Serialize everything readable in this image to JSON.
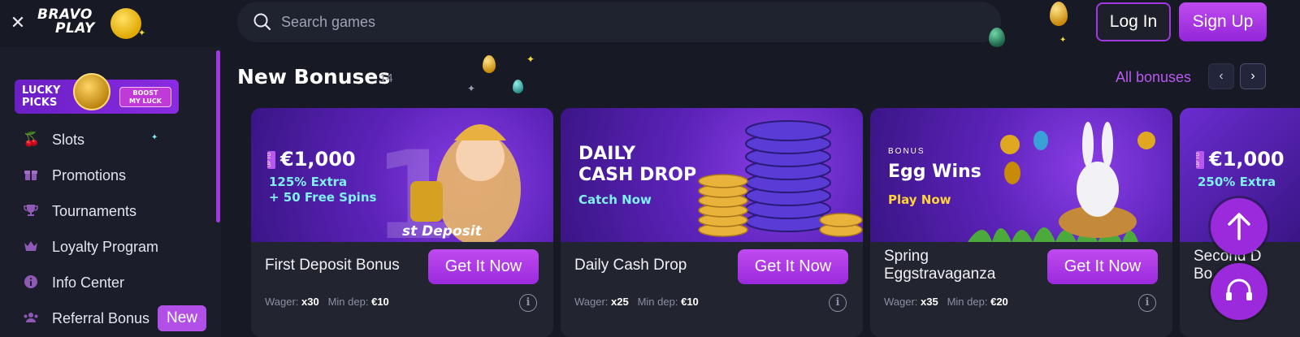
{
  "header": {
    "logo_line1": "BRAVO",
    "logo_line2": "PLAY",
    "search_placeholder": "Search games",
    "login_label": "Log In",
    "signup_label": "Sign Up"
  },
  "sidebar": {
    "promo": {
      "title_line1": "LUCKY",
      "title_line2": "PICKS",
      "button_line1": "BOOST",
      "button_line2": "MY LUCK"
    },
    "items": [
      {
        "label": "Slots",
        "icon": "cherries-icon"
      },
      {
        "label": "Promotions",
        "icon": "gift-icon"
      },
      {
        "label": "Tournaments",
        "icon": "trophy-icon"
      },
      {
        "label": "Loyalty Program",
        "icon": "crown-icon"
      },
      {
        "label": "Info Center",
        "icon": "info-icon"
      },
      {
        "label": "Referral Bonus",
        "icon": "users-icon",
        "badge": "New"
      }
    ]
  },
  "main": {
    "section_title": "New Bonuses",
    "section_count": "14",
    "all_link": "All bonuses",
    "cards": [
      {
        "banner_amount": "€1,000",
        "banner_upto": "UP TO",
        "banner_line1": "125% Extra",
        "banner_line2": "+ 50 Free Spins",
        "banner_deposit": "st Deposit",
        "name": "First Deposit Bonus",
        "cta": "Get It Now",
        "wager_label": "Wager:",
        "wager_value": "x30",
        "mindep_label": "Min dep:",
        "mindep_value": "€10"
      },
      {
        "banner_head_line1": "DAILY",
        "banner_head_line2": "CASH DROP",
        "banner_cta": "Catch Now",
        "name": "Daily Cash Drop",
        "cta": "Get It Now",
        "wager_label": "Wager:",
        "wager_value": "x25",
        "mindep_label": "Min dep:",
        "mindep_value": "€10"
      },
      {
        "banner_small": "BONUS",
        "banner_head": "Egg Wins",
        "banner_cta": "Play Now",
        "name": "Spring Eggstravaganza",
        "cta": "Get It Now",
        "wager_label": "Wager:",
        "wager_value": "x35",
        "mindep_label": "Min dep:",
        "mindep_value": "€20"
      },
      {
        "banner_amount": "€1,000",
        "banner_upto": "UP TO",
        "banner_line1": "250% Extra",
        "name_line1": "Second D",
        "name_line2": "Bo"
      }
    ]
  },
  "colors": {
    "accent": "#a238e0",
    "background": "#171a24",
    "card": "#22252f",
    "cyan_text": "#7ef0f6",
    "yellow_text": "#ffd43a"
  }
}
